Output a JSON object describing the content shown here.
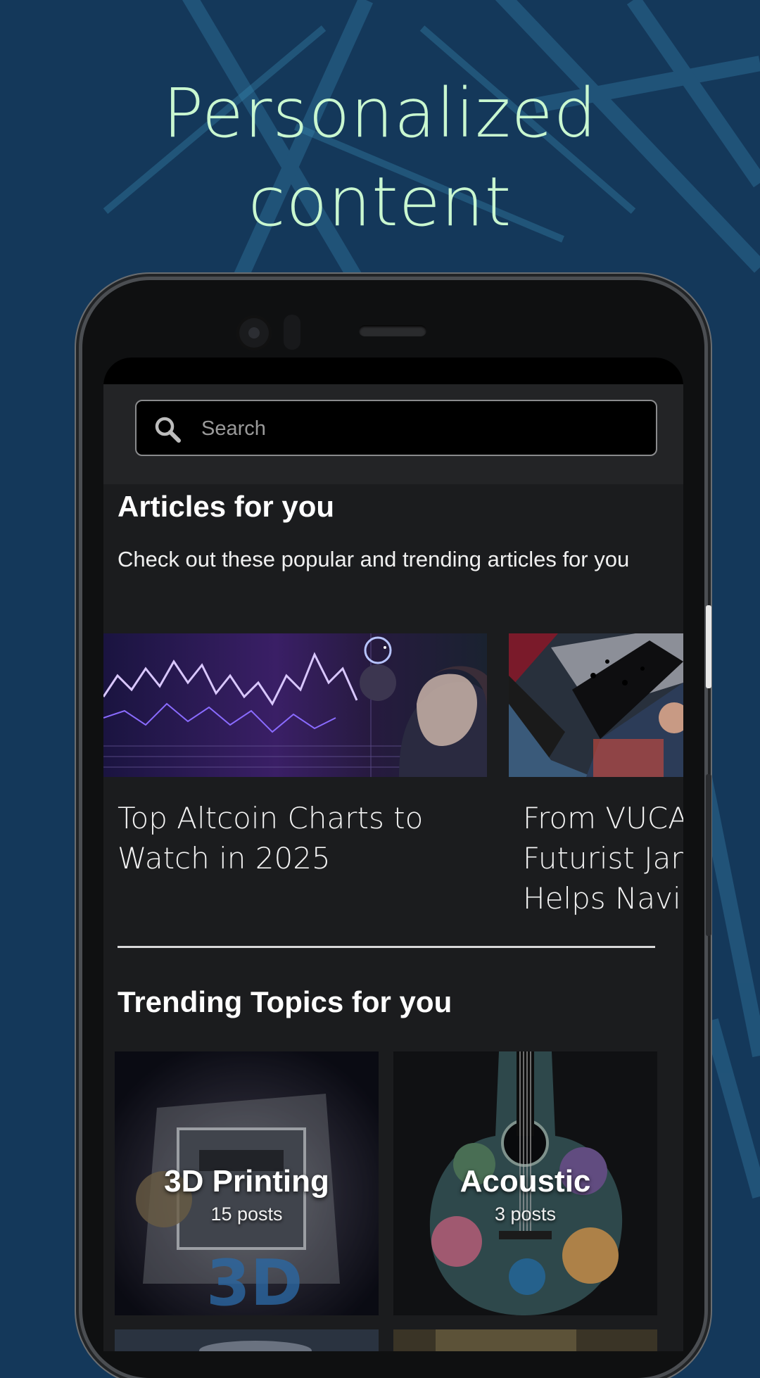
{
  "headline": {
    "line1": "Personalized",
    "line2": "content"
  },
  "search": {
    "placeholder": "Search"
  },
  "articles": {
    "title": "Articles for you",
    "description": "Check out these popular and trending articles for you",
    "items": [
      {
        "title": "Top Altcoin Charts to Watch in 2025"
      },
      {
        "title": "From VUCA to Futurist Jan Helps Navig"
      }
    ]
  },
  "topics": {
    "title": "Trending Topics for you",
    "items": [
      {
        "name": "3D Printing",
        "count": "15 posts"
      },
      {
        "name": "Acoustic",
        "count": "3 posts"
      }
    ]
  },
  "colors": {
    "headline": "#c9f7d0",
    "background": "#14385a",
    "screen": "#1b1c1e"
  }
}
